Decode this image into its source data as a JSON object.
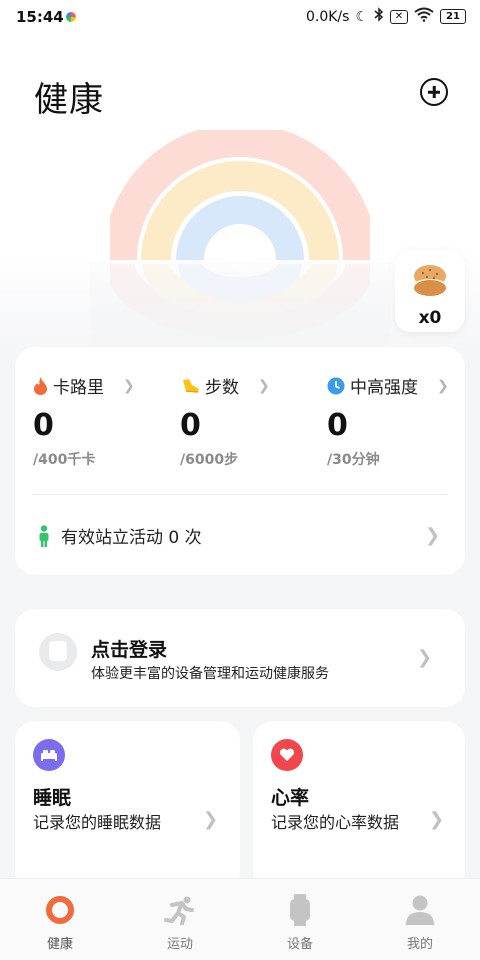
{
  "status_bar": {
    "time": "15:44",
    "net_speed": "0.0K/s",
    "battery": "21"
  },
  "header": {
    "title": "健康"
  },
  "badge": {
    "count": "x0"
  },
  "stats": {
    "calories": {
      "label": "卡路里",
      "value": "0",
      "goal": "/400千卡"
    },
    "steps": {
      "label": "步数",
      "value": "0",
      "goal": "/6000步"
    },
    "intensity": {
      "label": "中高强度",
      "value": "0",
      "goal": "/30分钟"
    },
    "stand_text": "有效站立活动  0  次"
  },
  "login": {
    "title": "点击登录",
    "subtitle": "体验更丰富的设备管理和运动健康服务"
  },
  "sleep": {
    "title": "睡眠",
    "subtitle": "记录您的睡眠数据"
  },
  "heart": {
    "title": "心率",
    "subtitle": "记录您的心率数据"
  },
  "nav": [
    {
      "label": "健康"
    },
    {
      "label": "运动"
    },
    {
      "label": "设备"
    },
    {
      "label": "我的"
    }
  ],
  "colors": {
    "accent": "#f26b3a",
    "rainbow_outer": "#fddcd6",
    "rainbow_middle": "#fdebc8",
    "rainbow_inner": "#d8e8fb",
    "stand_icon": "#34c46a",
    "sleep_icon": "#7b6cf0",
    "heart_icon": "#f2464d"
  }
}
